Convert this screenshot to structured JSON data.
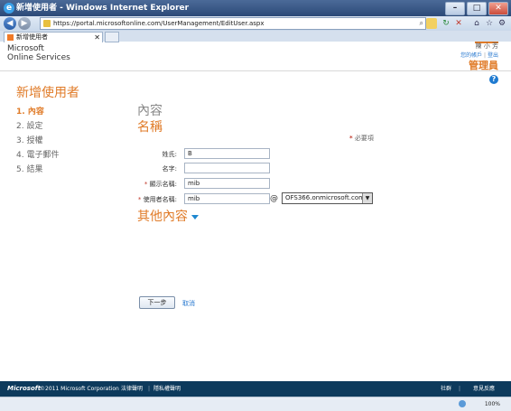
{
  "window": {
    "title": "新增使用者 - Windows Internet Explorer",
    "buttons": {
      "minimize": "–",
      "maximize": "□",
      "close": "✕"
    }
  },
  "browser": {
    "url": "https://portal.microsoftonline.com/UserManagement/EditUser.aspx",
    "search_glyph": "⌕",
    "tab_title": "新增使用者",
    "tab_close": "✕",
    "zoom": "100%"
  },
  "header": {
    "brand_line1": "Microsoft",
    "brand_line2": "Online Services",
    "user_name": "陳 小 芳",
    "link_account": "您的帳戶",
    "link_sep": "|",
    "link_signout": "登出",
    "role": "管理員",
    "help": "?"
  },
  "page": {
    "title": "新增使用者",
    "steps": [
      {
        "label": "1.  內容"
      },
      {
        "label": "2.  設定"
      },
      {
        "label": "3.  授權"
      },
      {
        "label": "4.  電子郵件"
      },
      {
        "label": "5.  結果"
      }
    ]
  },
  "form": {
    "section_title": "內容",
    "subsection_title": "名稱",
    "required_note": "必要項",
    "required_star": "*",
    "fields": {
      "last_name": {
        "label": "姓氏:",
        "value": "B"
      },
      "first_name": {
        "label": "名字:",
        "value": ""
      },
      "display_name": {
        "label": "顯示名稱:",
        "value": "mib"
      },
      "user_name": {
        "label": "使用者名稱:",
        "value": "mib"
      }
    },
    "at": "@",
    "domain_selected": "OFS366.onmicrosoft.com",
    "more_title": "其他內容",
    "next_button": "下一步",
    "cancel_link": "取消"
  },
  "footer": {
    "ms_logo": "Microsoft",
    "copyright": "©2011 Microsoft Corporation",
    "legal": "法律聲明",
    "sep": "|",
    "privacy": "隱私權聲明",
    "community": "社群",
    "feedback": "意見反應"
  }
}
